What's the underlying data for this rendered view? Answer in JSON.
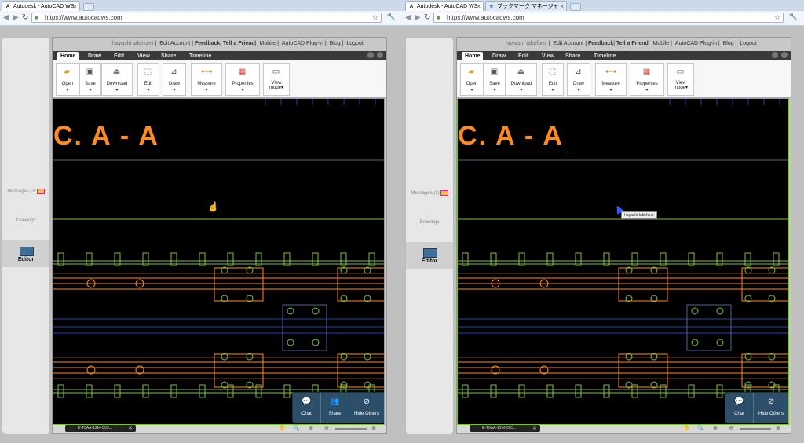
{
  "left": {
    "tabs": [
      {
        "label": "Autodesk - AutoCAD WS",
        "icon": "A"
      }
    ],
    "url": "https://www.autocadws.com",
    "links": [
      "hayashi takefumi",
      "Edit Account",
      "Feedback",
      "Tell a Friend",
      "Mobile",
      "AutoCAD Plug-in",
      "Blog",
      "Logout"
    ],
    "side": {
      "messages": "Messages (3)",
      "drawings": "Drawings",
      "editor": "Editor"
    },
    "ribbon_tabs": [
      "Home",
      "Draw",
      "Edit",
      "View",
      "Share",
      "Timeline"
    ],
    "tools": [
      "Open",
      "Save",
      "Download",
      "Edit",
      "Draw",
      "Measure",
      "Properties",
      "View mode"
    ],
    "tools_view_lines": [
      "View",
      "mode"
    ],
    "title": "C. A - A",
    "file": "E-T0AA-12M-C03...",
    "float": [
      "Chat",
      "Share",
      "Hide Others"
    ]
  },
  "right": {
    "tabs": [
      {
        "label": "Autodesk - AutoCAD WS",
        "icon": "A"
      },
      {
        "label": "ブックマーク マネージャ",
        "icon": "★"
      }
    ],
    "url": "https://www.autocadws.com",
    "links": [
      "hayashi takefumi",
      "Edit Account",
      "Feedback",
      "Tell a Friend",
      "Mobile",
      "AutoCAD Plug-in",
      "Blog",
      "Logout"
    ],
    "side": {
      "messages": "Messages (2)",
      "drawings": "Drawings",
      "editor": "Editor"
    },
    "ribbon_tabs": [
      "Home",
      "Draw",
      "Edit",
      "View",
      "Share",
      "Timeline"
    ],
    "tools": [
      "Open",
      "Save",
      "Download",
      "Edit",
      "Draw",
      "Measure",
      "Properties",
      "View mode"
    ],
    "title": "C. A - A",
    "file": "E-T0AA-12M-C03...",
    "float": [
      "Chat",
      "Hide Others"
    ],
    "collab_user": "hayashi takefumi"
  },
  "colors": {
    "cad_bg": "#000000",
    "cad_orange": "#ff8c1a",
    "cad_green": "#7fbf3c",
    "cad_blue": "#2040c0",
    "panel": "#2c4e68"
  }
}
